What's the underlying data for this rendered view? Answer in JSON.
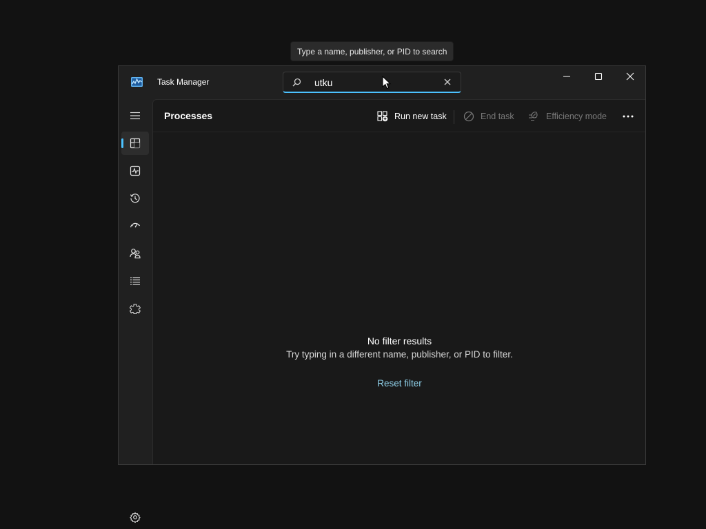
{
  "tooltip": "Type a name, publisher, or PID to search",
  "window": {
    "title": "Task Manager"
  },
  "search": {
    "value": "utku",
    "placeholder": "Type a name, publisher, or PID to search"
  },
  "sidebar": {
    "items": [
      {
        "icon": "processes-icon",
        "active": true
      },
      {
        "icon": "performance-icon",
        "active": false
      },
      {
        "icon": "app-history-icon",
        "active": false
      },
      {
        "icon": "startup-apps-icon",
        "active": false
      },
      {
        "icon": "users-icon",
        "active": false
      },
      {
        "icon": "details-icon",
        "active": false
      },
      {
        "icon": "services-icon",
        "active": false
      }
    ],
    "settings_icon": "settings-icon"
  },
  "main": {
    "title": "Processes",
    "commands": {
      "run_new_task": "Run new task",
      "end_task": "End task",
      "efficiency_mode": "Efficiency mode"
    },
    "empty_state": {
      "title": "No filter results",
      "message": "Try typing in a different name, publisher, or PID to filter.",
      "reset_link": "Reset filter"
    }
  },
  "colors": {
    "accent": "#4cc2ff",
    "link": "#8ecfe8",
    "disabled_text": "#7a7a7a"
  }
}
